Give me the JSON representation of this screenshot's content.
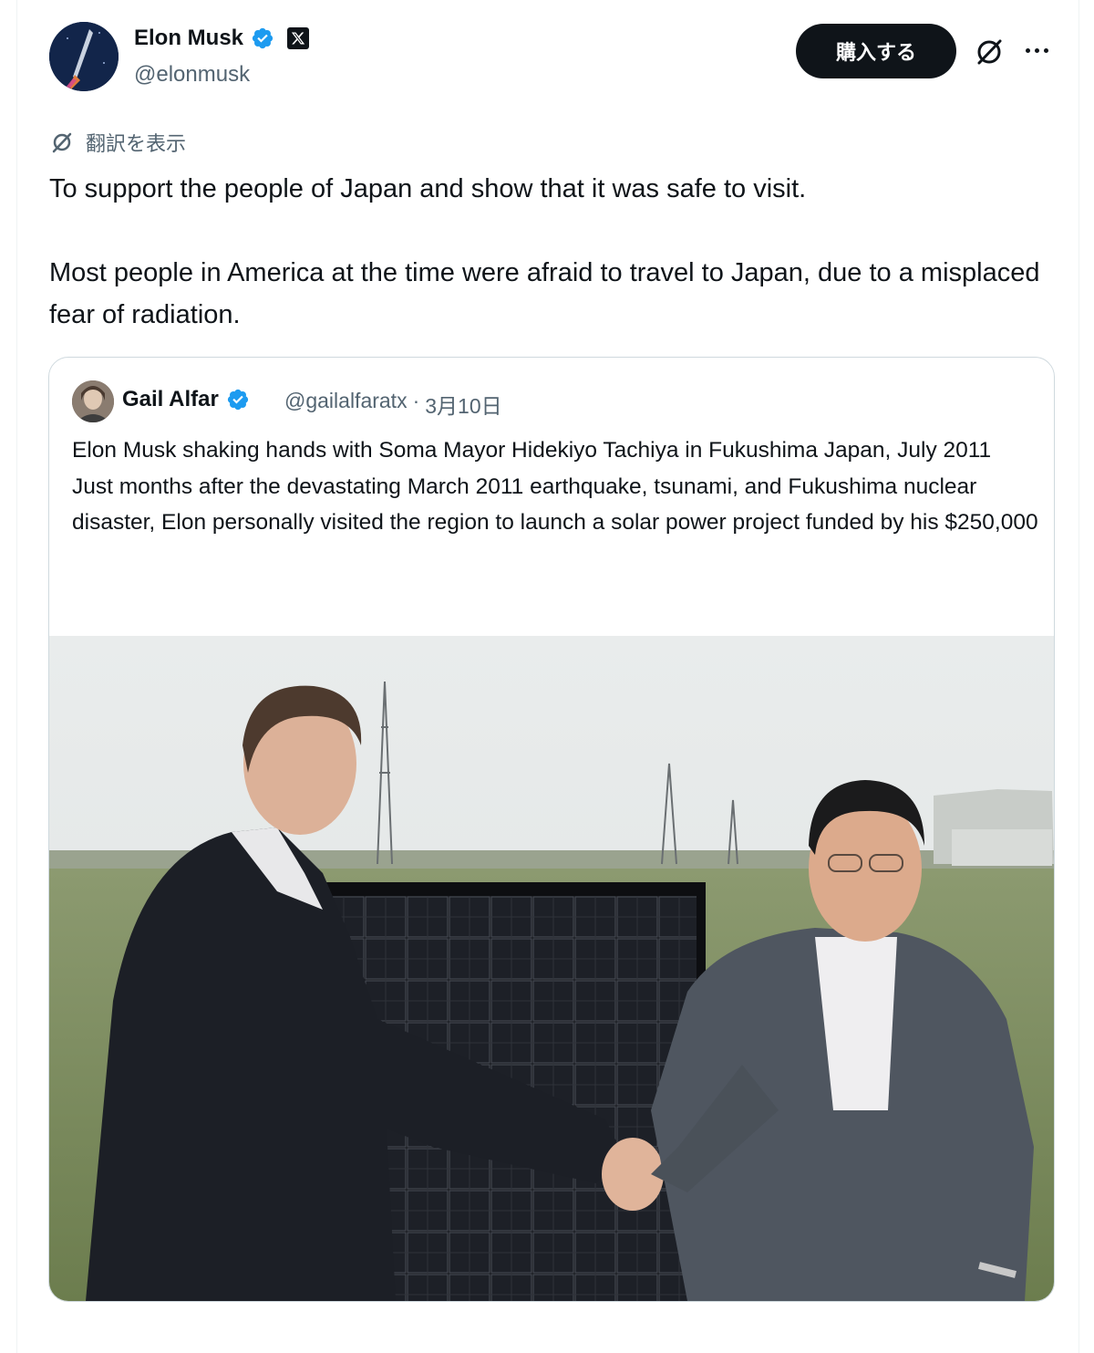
{
  "post": {
    "author_name": "Elon Musk",
    "author_handle": "@elonmusk",
    "buy_label": "購入する",
    "translate_label": "翻訳を表示",
    "text_line1": "To support the people of Japan and show that it was safe to visit.",
    "text_line2": "Most people in America at the time were afraid to travel to Japan, due to a misplaced fear of radiation."
  },
  "quoted": {
    "author_name": "Gail Alfar",
    "author_handle": "@gailalfaratx",
    "separator": "·",
    "date": "3月10日",
    "line1": "Elon Musk shaking hands with Soma Mayor Hidekiyo Tachiya in Fukushima Japan, July 2011",
    "line2": "Just months after the devastating March 2011 earthquake, tsunami, and Fukushima nuclear disaster, Elon personally visited the region to launch a solar power project funded by his $250,000"
  },
  "icons": {
    "verified": "verified-badge-icon",
    "x_logo": "x-logo-icon",
    "grok": "grok-icon",
    "more": "more-icon",
    "translate": "translate-icon"
  },
  "colors": {
    "accent": "#1d9bf0",
    "text": "#0f1419",
    "secondary": "#536471",
    "button_bg": "#0f1419"
  }
}
